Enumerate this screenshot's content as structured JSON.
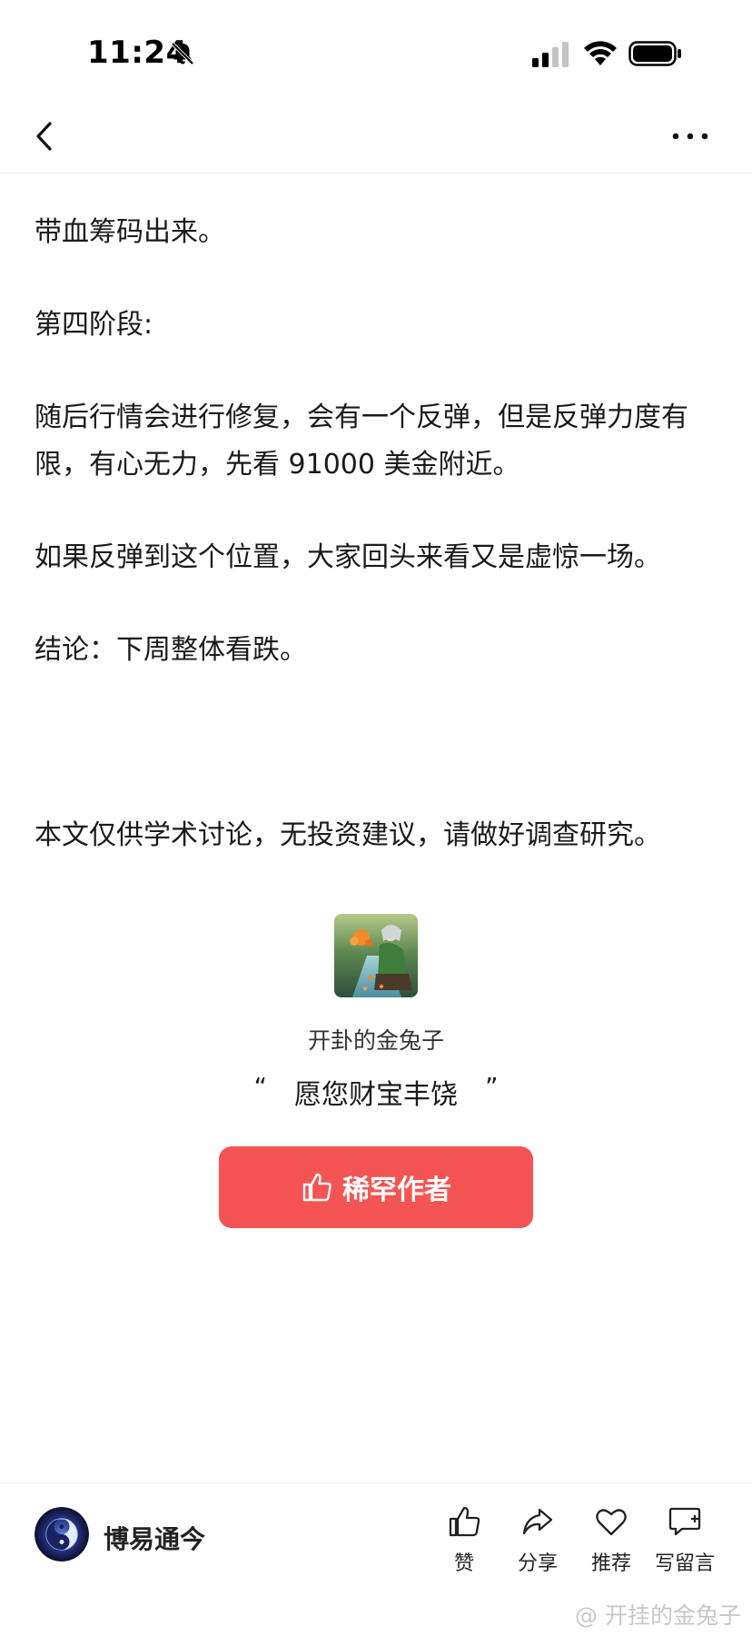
{
  "status_bar": {
    "time": "11:24",
    "icons": [
      "bell-slash-icon",
      "signal-icon",
      "wifi-icon",
      "battery-icon"
    ]
  },
  "nav": {
    "back_icon": "chevron-left-icon",
    "more_icon": "more-horizontal-icon"
  },
  "article": {
    "paragraphs": [
      "带血筹码出来。",
      "第四阶段:",
      "随后行情会进行修复，会有一个反弹，但是反弹力度有限，有心无力，先看 91000 美金附近。",
      "如果反弹到这个位置，大家回头来看又是虚惊一场。",
      "结论：下周整体看跌。",
      "本文仅供学术讨论，无投资建议，请做好调查研究。"
    ]
  },
  "author_card": {
    "name": "开卦的金兔子",
    "motto": "愿您财宝丰饶",
    "quote_open": "“",
    "quote_close": "”",
    "reward_button": "稀罕作者",
    "reward_icon": "thumbs-up-icon"
  },
  "bottom_bar": {
    "account_name": "博易通今",
    "actions": [
      {
        "label": "赞",
        "icon": "thumbs-up-icon"
      },
      {
        "label": "分享",
        "icon": "share-icon"
      },
      {
        "label": "推荐",
        "icon": "heart-icon"
      },
      {
        "label": "写留言",
        "icon": "comment-add-icon"
      }
    ],
    "watermark": "@ 开挂的金兔子"
  },
  "colors": {
    "accent": "#f55454",
    "text": "#1a1a1a",
    "divider": "#ececec"
  }
}
